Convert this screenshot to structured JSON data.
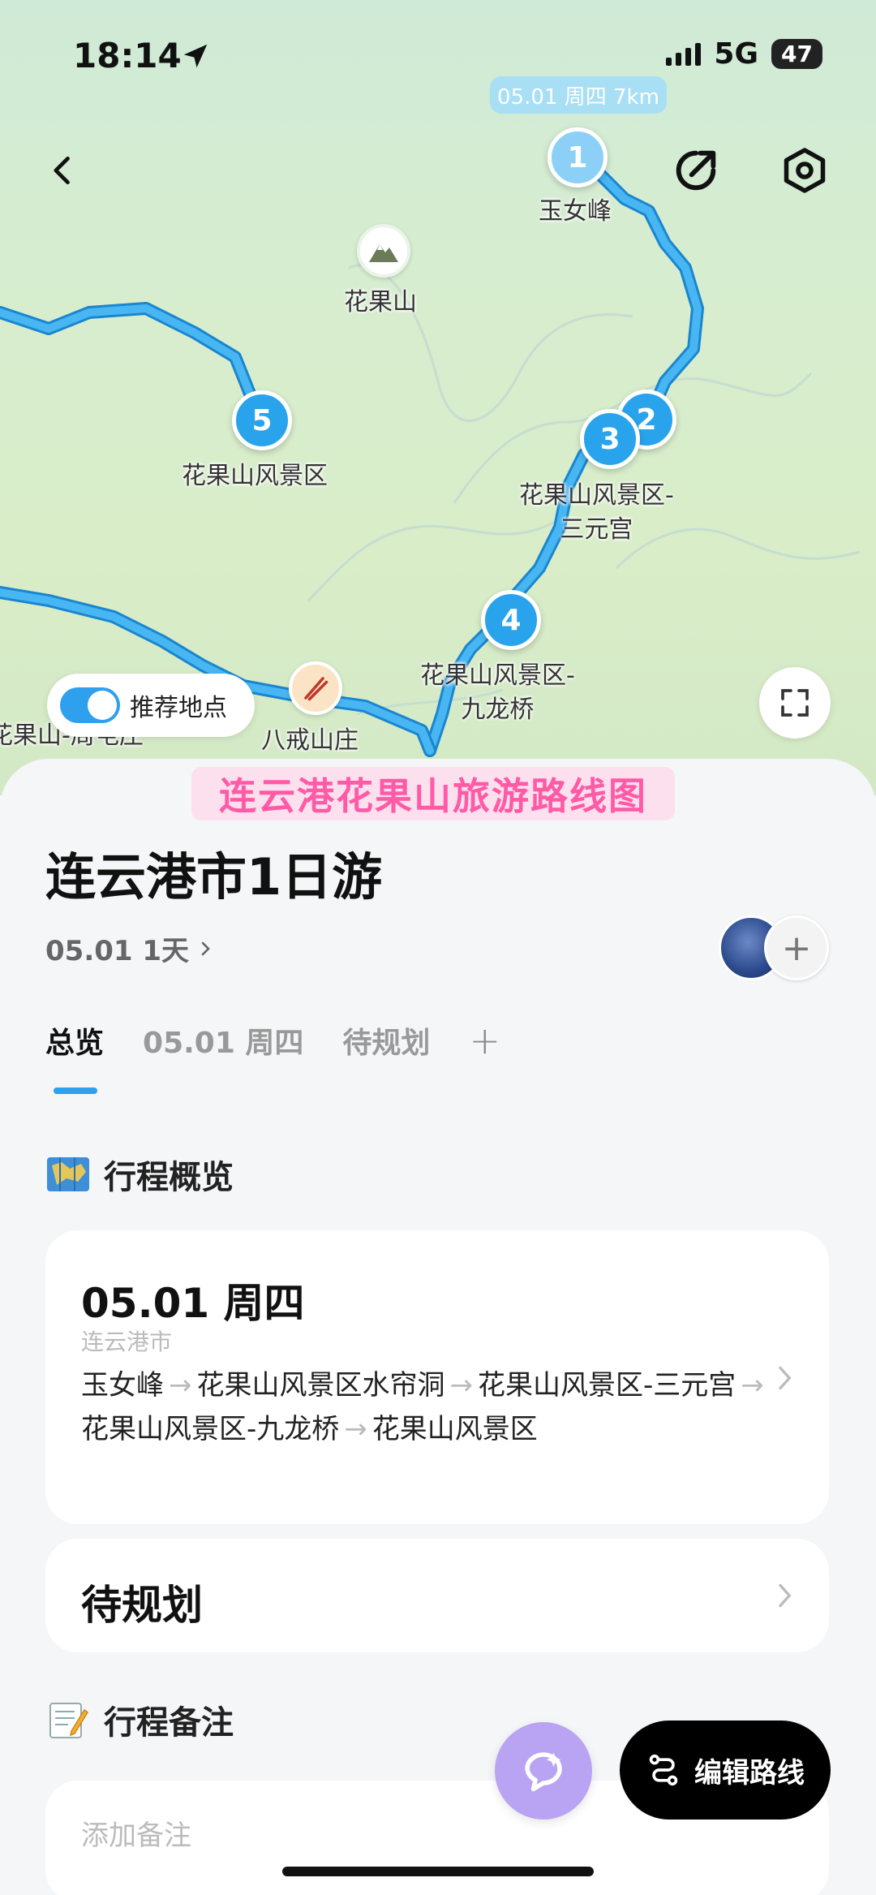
{
  "status_bar": {
    "time": "18:14",
    "network": "5G",
    "battery": "47"
  },
  "map": {
    "route_summary": "05.01 周四 7km",
    "markers": [
      {
        "num": "1",
        "label": "玉女峰"
      },
      {
        "num": "2",
        "label": ""
      },
      {
        "num": "3",
        "label": "花果山风景区-\n三元宫"
      },
      {
        "num": "4",
        "label": "花果山风景区-\n九龙桥"
      },
      {
        "num": "5",
        "label": "花果山风景区"
      }
    ],
    "pois": [
      {
        "label": "花果山",
        "icon": "mountain-icon"
      },
      {
        "label": "八戒山庄",
        "icon": "chopsticks-icon"
      },
      {
        "label": "花果山-周屯庄",
        "icon": ""
      }
    ],
    "toggle_label": "推荐地点",
    "colors": {
      "route": "#2a9fe6",
      "marker": "#29a3ec"
    }
  },
  "banner": "连云港花果山旅游路线图",
  "trip": {
    "title": "连云港市1日游",
    "meta": "05.01 1天",
    "avatar_add": "+"
  },
  "tabs": [
    {
      "label": "总览",
      "active": true
    },
    {
      "label": "05.01 周四",
      "active": false
    },
    {
      "label": "待规划",
      "active": false
    },
    {
      "label": "+",
      "active": false
    }
  ],
  "overview": {
    "heading": "行程概览",
    "day_card": {
      "date": "05.01 周四",
      "city": "连云港市",
      "stops": [
        "玉女峰",
        "花果山风景区水帘洞",
        "花果山风景区-三元宫",
        "花果山风景区-九龙桥",
        "花果山风景区"
      ]
    },
    "pending_title": "待规划"
  },
  "notes": {
    "heading": "行程备注",
    "placeholder": "添加备注"
  },
  "actions": {
    "edit_route": "编辑路线"
  }
}
